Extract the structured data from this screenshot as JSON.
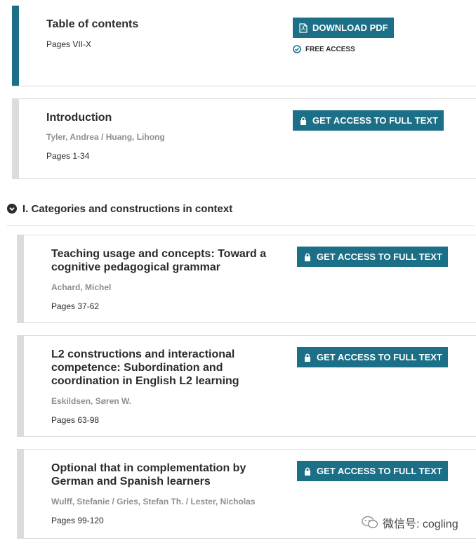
{
  "colors": {
    "accent": "#1b6f86",
    "bar_gray": "#dcdcdc",
    "muted": "#8f8f8f"
  },
  "toc": {
    "title": "Table of contents",
    "pages": "Pages VII-X",
    "button_label": "DOWNLOAD PDF",
    "button_icon": "pdf-icon",
    "free_label": "FREE ACCESS",
    "free_icon": "check-circle-icon"
  },
  "intro": {
    "title": "Introduction",
    "authors": "Tyler, Andrea / Huang, Lihong",
    "pages": "Pages 1-34",
    "button_label": "GET ACCESS TO FULL TEXT",
    "button_icon": "lock-icon"
  },
  "section": {
    "label": "I. Categories and constructions in context",
    "icon": "chevron-down-circle-icon"
  },
  "chapters": [
    {
      "title_line1": "Teaching usage and concepts: Toward a",
      "title_line2": "cognitive pedagogical grammar",
      "title_line3": "",
      "authors": "Achard, Michel",
      "pages": "Pages 37-62",
      "button_label": "GET ACCESS TO FULL TEXT"
    },
    {
      "title_line1": "L2 constructions and interactional",
      "title_line2": "competence: Subordination and",
      "title_line3": "coordination in English L2 learning",
      "authors": "Eskildsen, Søren W.",
      "pages": "Pages 63-98",
      "button_label": "GET ACCESS TO FULL TEXT"
    },
    {
      "title_line1": "Optional that in complementation by",
      "title_line2": "German and Spanish learners",
      "title_line3": "",
      "authors": "Wulff, Stefanie / Gries, Stefan Th. / Lester, Nicholas",
      "pages": "Pages 99-120",
      "button_label": "GET ACCESS TO FULL TEXT"
    }
  ],
  "watermark": {
    "text": "微信号: cogling",
    "icon": "wechat-icon"
  }
}
